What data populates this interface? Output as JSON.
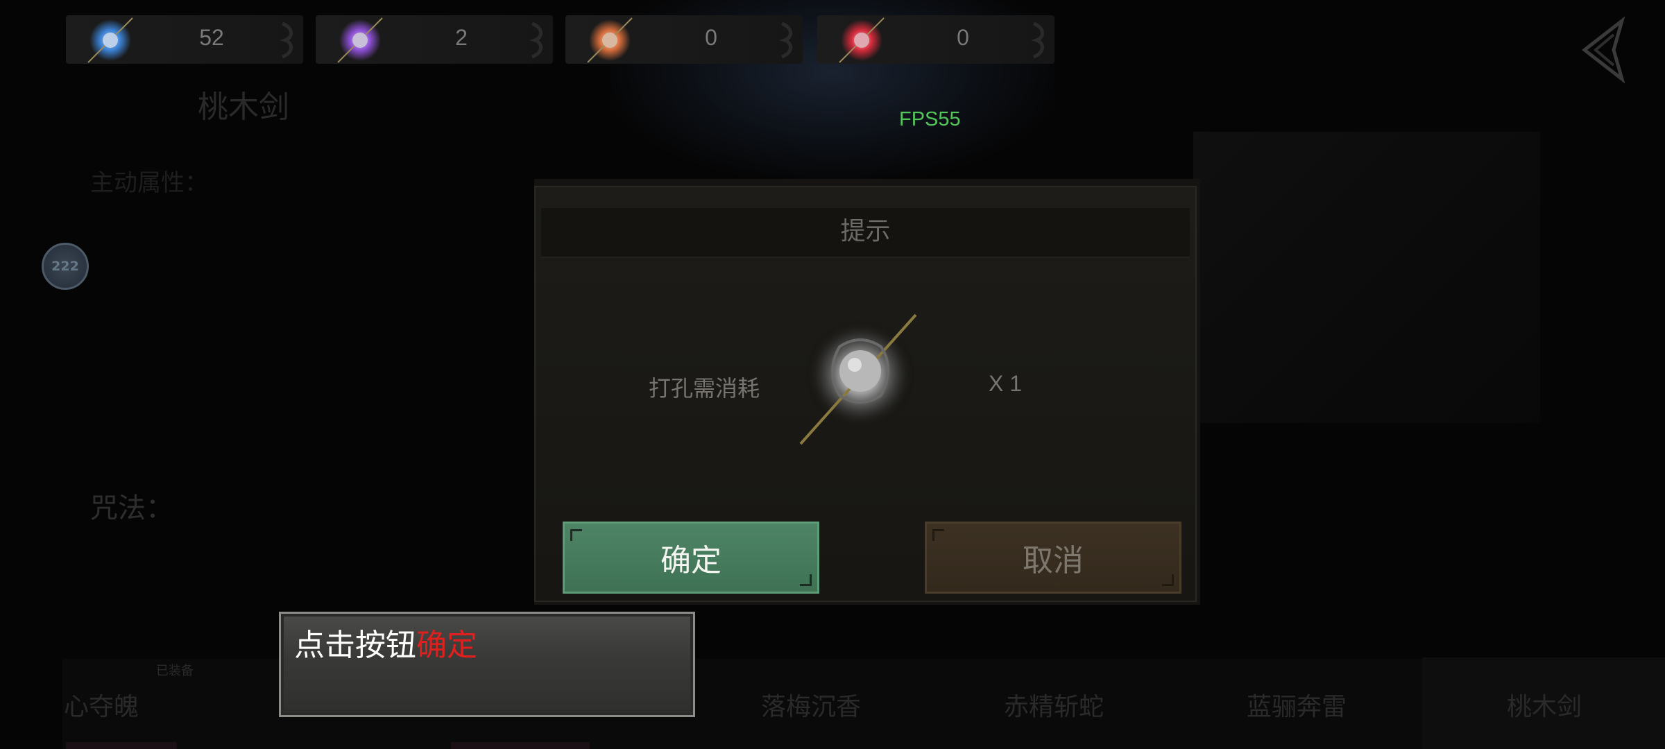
{
  "resources": [
    {
      "name": "blue-gem",
      "value": "52",
      "color": "#3a7fd0"
    },
    {
      "name": "purple-gem",
      "value": "2",
      "color": "#8a4ed0"
    },
    {
      "name": "orange-gem",
      "value": "0",
      "color": "#d06a3a"
    },
    {
      "name": "red-gem",
      "value": "0",
      "color": "#d02a3a"
    }
  ],
  "fps": "FPS55",
  "background": {
    "weapon_title": "桃木剑",
    "spell_slot_label": "主动属性：",
    "spell_label": "咒法：",
    "level_badge": "222",
    "equipped_tag": "已装备",
    "tabs": [
      "心夺魄",
      "落梅沉香",
      "赤精斩蛇",
      "蓝骊奔雷",
      "桃木剑"
    ]
  },
  "dialog": {
    "title": "提示",
    "cost_label": "打孔需消耗",
    "cost_quantity": "X 1",
    "confirm_label": "确定",
    "cancel_label": "取消"
  },
  "hint": {
    "prefix": "点击按钮",
    "highlight": "确定"
  },
  "colors": {
    "fps": "#53c65a",
    "confirm": "#4e8466",
    "cancel": "#3c3123",
    "hint_highlight": "#e0201e"
  }
}
